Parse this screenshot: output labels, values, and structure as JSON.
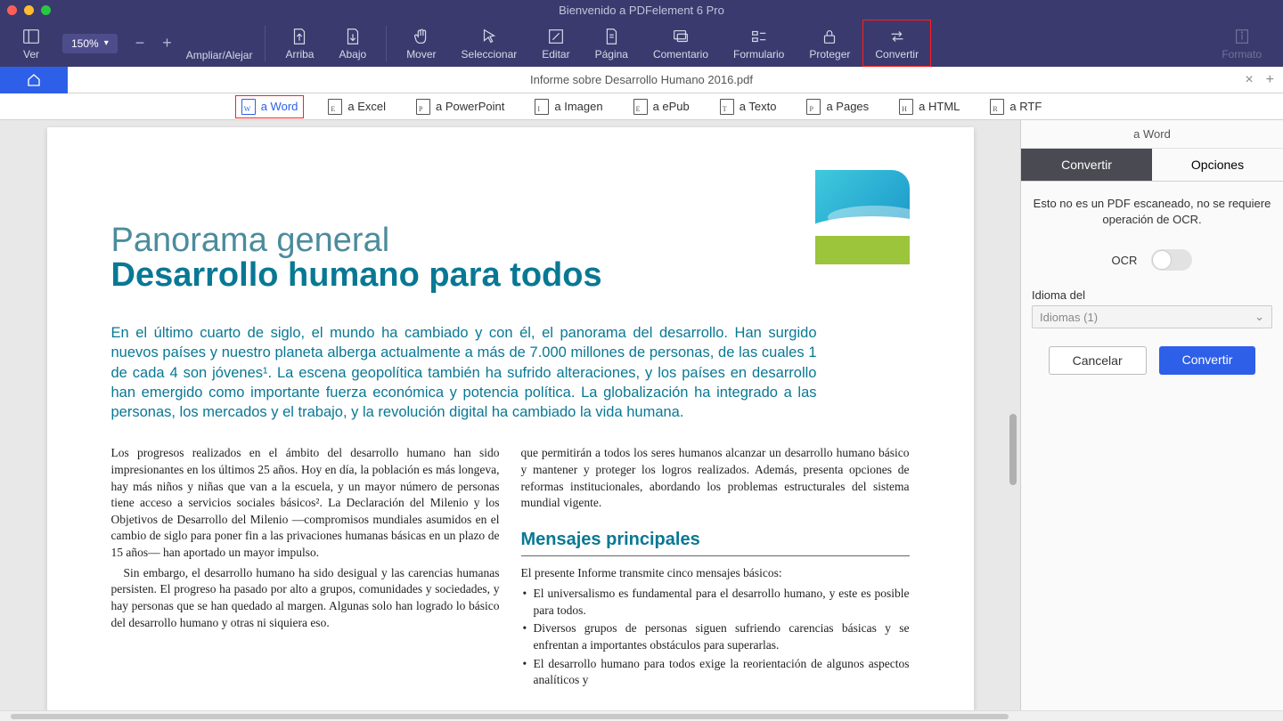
{
  "window_title": "Bienvenido a PDFelement 6 Pro",
  "zoom": "150%",
  "toolbar": {
    "ver": "Ver",
    "ampliar": "Ampliar/Alejar",
    "arriba": "Arriba",
    "abajo": "Abajo",
    "mover": "Mover",
    "seleccionar": "Seleccionar",
    "editar": "Editar",
    "pagina": "Página",
    "comentario": "Comentario",
    "formulario": "Formulario",
    "proteger": "Proteger",
    "convertir": "Convertir",
    "formato": "Formato"
  },
  "doc_title": "Informe sobre Desarrollo Humano 2016.pdf",
  "convert_row": {
    "word": "a Word",
    "excel": "a Excel",
    "ppt": "a PowerPoint",
    "imagen": "a Imagen",
    "epub": "a ePub",
    "texto": "a Texto",
    "pages": "a Pages",
    "html": "a HTML",
    "rtf": "a RTF"
  },
  "doc": {
    "h1a": "Panorama general",
    "h1b": "Desarrollo humano para todos",
    "intro": "En el último cuarto de siglo, el mundo ha cambiado y con él, el panorama del desarrollo. Han surgido nuevos países y nuestro planeta alberga actualmente a más de 7.000 millones de personas, de las cuales 1 de cada 4 son jóvenes¹. La escena geopolítica también ha sufrido alteraciones, y los países en desarrollo han emergido como importante fuerza económica y potencia política. La globalización ha integrado a las personas, los mercados y el trabajo, y la revolución digital ha cambiado la vida humana.",
    "col1p1": "Los progresos realizados en el ámbito del desarrollo humano han sido impresionantes en los últimos 25 años. Hoy en día, la población es más longeva, hay más niños y niñas que van a la escuela, y un mayor número de personas tiene acceso a servicios sociales básicos². La Declaración del Milenio y los Objetivos de Desarrollo del Milenio —compromisos mundiales asumidos en el cambio de siglo para poner fin a las privaciones humanas básicas en un plazo de 15 años— han aportado un mayor impulso.",
    "col1p2": "Sin embargo, el desarrollo humano ha sido desigual y las carencias humanas persisten. El progreso ha pasado por alto a grupos, comunidades y sociedades, y hay personas que se han quedado al margen. Algunas solo han logrado lo básico del desarrollo humano y otras ni siquiera eso.",
    "col2p1": "que permitirán a todos los seres humanos alcanzar un desarrollo humano básico y mantener y proteger los logros realizados. Además, presenta opciones de reformas institucionales, abordando los problemas estructurales del sistema mundial vigente.",
    "col2h": "Mensajes principales",
    "col2p2": "El presente Informe transmite cinco mensajes básicos:",
    "li1": "El universalismo es fundamental para el desarrollo humano, y este es posible para todos.",
    "li2": "Diversos grupos de personas siguen sufriendo carencias básicas y se enfrentan a importantes obstáculos para superarlas.",
    "li3": "El desarrollo humano para todos exige la reorientación de algunos aspectos analíticos y"
  },
  "side": {
    "title": "a Word",
    "tab_convertir": "Convertir",
    "tab_opciones": "Opciones",
    "msg": "Esto no es un PDF escaneado, no se requiere operación de OCR.",
    "ocr": "OCR",
    "lang_label": "Idioma del",
    "lang_value": "Idiomas (1)",
    "cancel": "Cancelar",
    "convert": "Convertir"
  }
}
